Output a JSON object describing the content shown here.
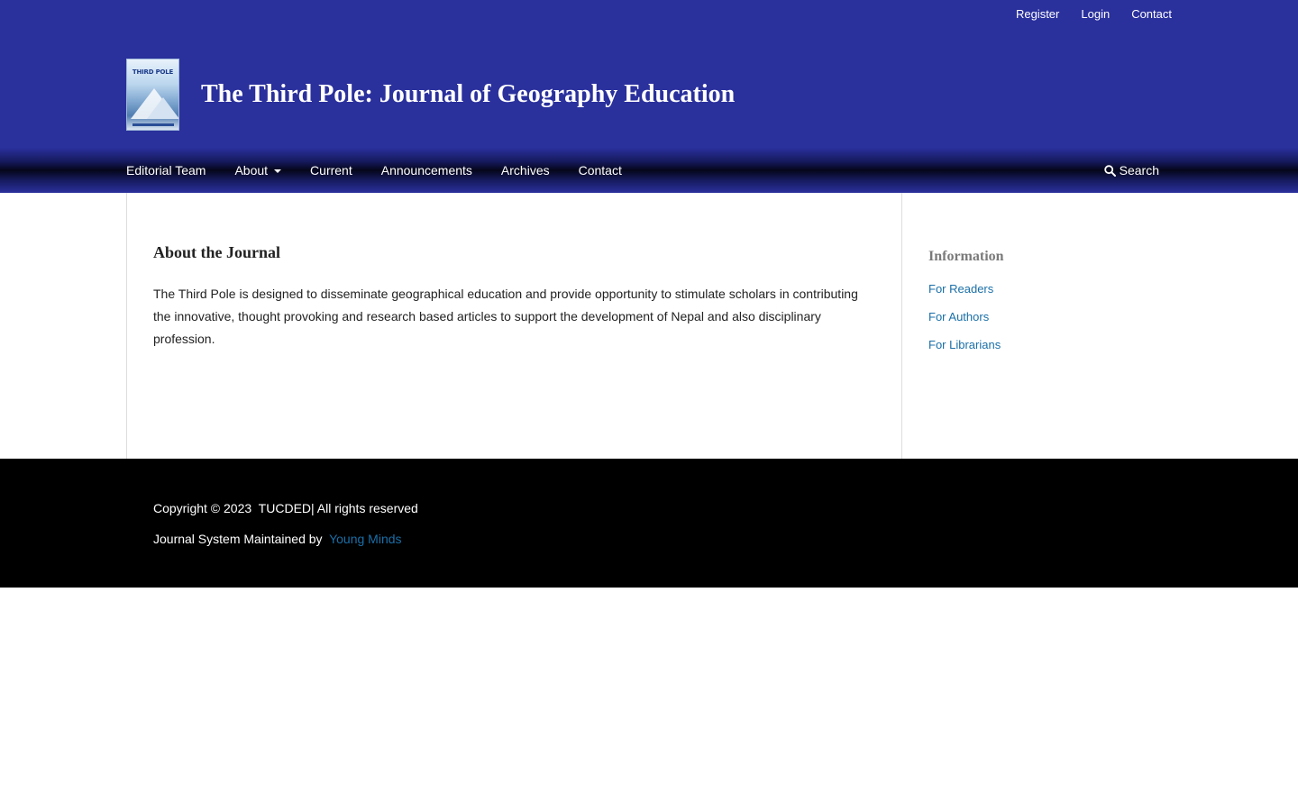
{
  "user_nav": {
    "register": "Register",
    "login": "Login",
    "contact": "Contact"
  },
  "header": {
    "site_title": "The Third Pole: Journal of Geography Education",
    "logo_text": "THIRD POLE"
  },
  "primary_nav": {
    "items": [
      "Editorial Team",
      "About",
      "Current",
      "Announcements",
      "Archives",
      "Contact"
    ],
    "search": "Search"
  },
  "main": {
    "heading": "About the Journal",
    "body": "The Third Pole is designed to disseminate geographical education and provide opportunity to stimulate scholars in contributing the innovative, thought provoking and research based articles to support the development of Nepal and also disciplinary profession."
  },
  "sidebar": {
    "heading": "Information",
    "links": [
      "For Readers",
      "For Authors",
      "For Librarians"
    ]
  },
  "footer": {
    "copyright": "Copyright © 2023  TUCDED| All rights reserved",
    "maintained_prefix": "Journal System Maintained by  ",
    "maintained_link": "Young Minds"
  },
  "colors": {
    "header_bg": "#2a309c",
    "link": "#1a6fa8",
    "footer_bg": "#000000"
  }
}
